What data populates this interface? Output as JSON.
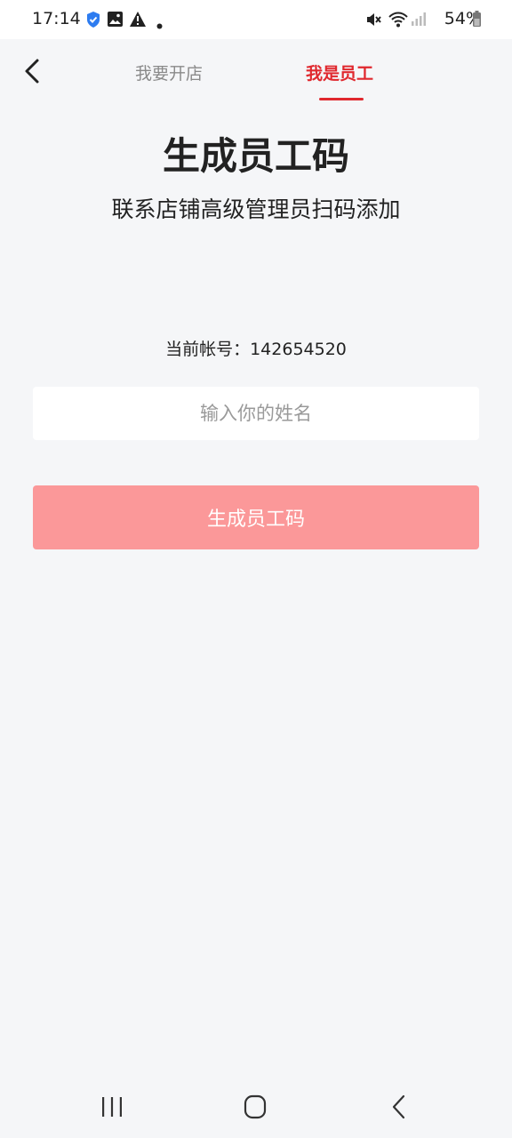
{
  "status_bar": {
    "time": "17:14",
    "battery": "54%",
    "icons_left": [
      "shield-check-icon",
      "image-icon",
      "warning-icon",
      "dot-icon"
    ],
    "icons_right": [
      "mute-icon",
      "wifi-icon",
      "signal-icon",
      "battery-icon"
    ]
  },
  "header": {
    "back_icon": "chevron-left-icon",
    "tabs": [
      {
        "label": "我要开店",
        "active": false
      },
      {
        "label": "我是员工",
        "active": true
      }
    ],
    "active_color": "#e0282e"
  },
  "main": {
    "title": "生成员工码",
    "subtitle": "联系店铺高级管理员扫码添加",
    "account_text": "当前帐号：142654520",
    "name_input": {
      "placeholder": "输入你的姓名",
      "value": ""
    },
    "generate_button": "生成员工码",
    "button_color": "#fb9899"
  },
  "nav_bar": {
    "buttons": [
      "recent-apps-icon",
      "home-icon",
      "back-icon"
    ]
  }
}
